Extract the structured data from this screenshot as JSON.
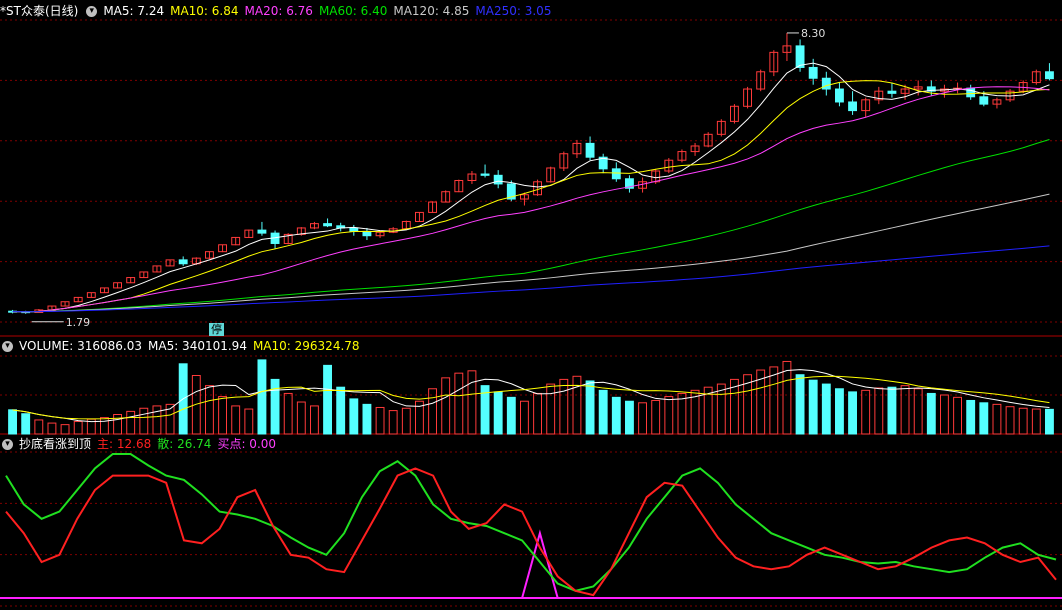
{
  "colors": {
    "up": "#ff3a3a",
    "down": "#54ffff",
    "ma5": "#ffffff",
    "ma10": "#ffff00",
    "ma20": "#ff40ff",
    "ma60": "#00e000",
    "ma120": "#c8c8c8",
    "ma250": "#2020ff",
    "main": "#ff2020",
    "retail": "#20e020",
    "buy": "#ff20ff",
    "grid": "#800000"
  },
  "price_panel": {
    "title": "*ST众泰(日线)",
    "icon": "chevron-down-icon",
    "ma5_label": "MA5: 7.24",
    "ma10_label": "MA10: 6.84",
    "ma20_label": "MA20: 6.76",
    "ma60_label": "MA60: 6.40",
    "ma120_label": "MA120: 4.85",
    "ma250_label": "MA250: 3.05",
    "high_label": "8.30",
    "low_label": "1.79",
    "halt_label": "停"
  },
  "volume_panel": {
    "icon": "chevron-down-icon",
    "volume_label": "VOLUME: 316086.03",
    "ma5_label": "MA5: 340101.94",
    "ma10_label": "MA10: 296324.78"
  },
  "indicator_panel": {
    "icon": "chevron-down-icon",
    "name": "抄底看涨到顶",
    "main_label": "主: 12.68",
    "retail_label": "散: 26.74",
    "buy_label": "买点: 0.00"
  },
  "chart_data": [
    {
      "type": "candlestick",
      "title": "*ST众泰(日线)",
      "ylim": [
        1.6,
        8.6
      ],
      "annotations": [
        {
          "text": "8.30",
          "kind": "high"
        },
        {
          "text": "1.79",
          "kind": "low"
        },
        {
          "text": "停",
          "kind": "halt"
        }
      ],
      "ohlc": [
        [
          1.85,
          1.88,
          1.8,
          1.84
        ],
        [
          1.84,
          1.86,
          1.79,
          1.82
        ],
        [
          1.82,
          1.9,
          1.81,
          1.88
        ],
        [
          1.88,
          1.97,
          1.87,
          1.97
        ],
        [
          1.97,
          2.07,
          1.96,
          2.07
        ],
        [
          2.07,
          2.18,
          2.06,
          2.17
        ],
        [
          2.17,
          2.28,
          2.16,
          2.28
        ],
        [
          2.28,
          2.4,
          2.27,
          2.39
        ],
        [
          2.39,
          2.51,
          2.38,
          2.51
        ],
        [
          2.51,
          2.64,
          2.5,
          2.63
        ],
        [
          2.63,
          2.77,
          2.62,
          2.76
        ],
        [
          2.76,
          2.9,
          2.75,
          2.9
        ],
        [
          2.9,
          3.04,
          2.89,
          3.04
        ],
        [
          3.04,
          3.12,
          2.9,
          2.95
        ],
        [
          2.95,
          3.1,
          2.92,
          3.08
        ],
        [
          3.08,
          3.24,
          3.06,
          3.23
        ],
        [
          3.23,
          3.39,
          3.22,
          3.39
        ],
        [
          3.39,
          3.56,
          3.38,
          3.56
        ],
        [
          3.56,
          3.74,
          3.55,
          3.73
        ],
        [
          3.73,
          3.92,
          3.6,
          3.66
        ],
        [
          3.66,
          3.72,
          3.3,
          3.42
        ],
        [
          3.42,
          3.66,
          3.4,
          3.63
        ],
        [
          3.63,
          3.8,
          3.6,
          3.78
        ],
        [
          3.78,
          3.92,
          3.75,
          3.88
        ],
        [
          3.88,
          4.0,
          3.8,
          3.83
        ],
        [
          3.83,
          3.9,
          3.7,
          3.78
        ],
        [
          3.78,
          3.85,
          3.6,
          3.7
        ],
        [
          3.7,
          3.78,
          3.5,
          3.6
        ],
        [
          3.6,
          3.72,
          3.55,
          3.68
        ],
        [
          3.68,
          3.8,
          3.66,
          3.76
        ],
        [
          3.76,
          3.95,
          3.74,
          3.93
        ],
        [
          3.93,
          4.15,
          3.92,
          4.14
        ],
        [
          4.14,
          4.4,
          4.13,
          4.38
        ],
        [
          4.38,
          4.65,
          4.37,
          4.62
        ],
        [
          4.62,
          4.9,
          4.61,
          4.88
        ],
        [
          4.88,
          5.1,
          4.8,
          5.03
        ],
        [
          5.03,
          5.25,
          4.95,
          5.0
        ],
        [
          5.0,
          5.12,
          4.7,
          4.8
        ],
        [
          4.8,
          4.88,
          4.4,
          4.45
        ],
        [
          4.45,
          4.6,
          4.3,
          4.55
        ],
        [
          4.55,
          4.9,
          4.52,
          4.85
        ],
        [
          4.85,
          5.2,
          4.83,
          5.17
        ],
        [
          5.17,
          5.55,
          5.1,
          5.5
        ],
        [
          5.5,
          5.82,
          5.4,
          5.74
        ],
        [
          5.74,
          5.9,
          5.35,
          5.42
        ],
        [
          5.42,
          5.5,
          5.05,
          5.15
        ],
        [
          5.15,
          5.3,
          4.85,
          4.92
        ],
        [
          4.92,
          5.0,
          4.6,
          4.7
        ],
        [
          4.7,
          4.95,
          4.6,
          4.85
        ],
        [
          4.85,
          5.15,
          4.8,
          5.1
        ],
        [
          5.1,
          5.4,
          5.05,
          5.35
        ],
        [
          5.35,
          5.6,
          5.3,
          5.55
        ],
        [
          5.55,
          5.75,
          5.45,
          5.68
        ],
        [
          5.68,
          6.0,
          5.65,
          5.95
        ],
        [
          5.95,
          6.3,
          5.9,
          6.25
        ],
        [
          6.25,
          6.65,
          6.2,
          6.6
        ],
        [
          6.6,
          7.05,
          6.55,
          7.0
        ],
        [
          7.0,
          7.45,
          6.95,
          7.4
        ],
        [
          7.4,
          7.9,
          7.3,
          7.85
        ],
        [
          7.85,
          8.3,
          7.65,
          8.0
        ],
        [
          8.0,
          8.15,
          7.4,
          7.5
        ],
        [
          7.5,
          7.7,
          7.1,
          7.25
        ],
        [
          7.25,
          7.4,
          6.85,
          7.0
        ],
        [
          7.0,
          7.15,
          6.6,
          6.7
        ],
        [
          6.7,
          6.95,
          6.4,
          6.5
        ],
        [
          6.5,
          6.8,
          6.35,
          6.75
        ],
        [
          6.75,
          7.05,
          6.65,
          6.95
        ],
        [
          6.95,
          7.15,
          6.8,
          6.9
        ],
        [
          6.9,
          7.1,
          6.75,
          7.0
        ],
        [
          7.0,
          7.2,
          6.85,
          7.05
        ],
        [
          7.05,
          7.2,
          6.85,
          6.95
        ],
        [
          6.95,
          7.1,
          6.8,
          7.0
        ],
        [
          7.0,
          7.15,
          6.9,
          7.02
        ],
        [
          7.02,
          7.1,
          6.75,
          6.82
        ],
        [
          6.82,
          6.95,
          6.6,
          6.65
        ],
        [
          6.65,
          6.8,
          6.55,
          6.75
        ],
        [
          6.75,
          7.0,
          6.7,
          6.95
        ],
        [
          6.95,
          7.2,
          6.9,
          7.15
        ],
        [
          7.15,
          7.45,
          7.1,
          7.4
        ],
        [
          7.4,
          7.6,
          7.2,
          7.24
        ]
      ],
      "ma_series": [
        "MA5",
        "MA10",
        "MA20",
        "MA60",
        "MA120",
        "MA250"
      ]
    },
    {
      "type": "bar",
      "title": "VOLUME",
      "ylim": [
        0,
        1000000
      ],
      "series": [
        {
          "name": "VOLUME",
          "values": [
            310000,
            260000,
            180000,
            140000,
            120000,
            160000,
            190000,
            210000,
            250000,
            290000,
            330000,
            360000,
            380000,
            900000,
            750000,
            620000,
            480000,
            360000,
            320000,
            950000,
            700000,
            520000,
            410000,
            360000,
            880000,
            600000,
            450000,
            380000,
            340000,
            300000,
            330000,
            420000,
            580000,
            720000,
            780000,
            810000,
            620000,
            540000,
            470000,
            420000,
            520000,
            640000,
            700000,
            740000,
            680000,
            560000,
            470000,
            420000,
            400000,
            430000,
            480000,
            520000,
            560000,
            600000,
            640000,
            700000,
            760000,
            820000,
            860000,
            930000,
            760000,
            690000,
            640000,
            580000,
            540000,
            560000,
            590000,
            600000,
            620000,
            580000,
            520000,
            500000,
            470000,
            430000,
            400000,
            380000,
            350000,
            330000,
            320000,
            316086
          ]
        }
      ]
    },
    {
      "type": "line",
      "title": "抄底看涨到顶",
      "series": [
        {
          "name": "主",
          "values": [
            60,
            45,
            25,
            30,
            55,
            75,
            85,
            85,
            85,
            80,
            40,
            38,
            48,
            70,
            75,
            50,
            30,
            28,
            20,
            18,
            40,
            62,
            85,
            90,
            85,
            60,
            48,
            52,
            65,
            60,
            35,
            15,
            5,
            2,
            20,
            45,
            70,
            80,
            78,
            60,
            42,
            28,
            22,
            20,
            22,
            30,
            35,
            30,
            25,
            20,
            22,
            28,
            35,
            40,
            42,
            38,
            30,
            25,
            28,
            12.68
          ]
        },
        {
          "name": "散",
          "values": [
            85,
            65,
            55,
            60,
            75,
            90,
            100,
            100,
            92,
            85,
            82,
            72,
            60,
            58,
            55,
            50,
            42,
            35,
            30,
            45,
            70,
            88,
            95,
            85,
            65,
            55,
            52,
            50,
            45,
            40,
            25,
            10,
            5,
            8,
            20,
            35,
            55,
            70,
            85,
            90,
            80,
            65,
            55,
            45,
            40,
            35,
            30,
            28,
            25,
            24,
            25,
            22,
            20,
            18,
            20,
            28,
            35,
            38,
            30,
            26.74
          ]
        },
        {
          "name": "买点",
          "values": [
            0,
            0,
            0,
            0,
            0,
            0,
            0,
            0,
            0,
            0,
            0,
            0,
            0,
            0,
            0,
            0,
            0,
            0,
            0,
            0,
            0,
            0,
            0,
            0,
            0,
            0,
            0,
            0,
            0,
            0,
            45,
            0,
            0,
            0,
            0,
            0,
            0,
            0,
            0,
            0,
            0,
            0,
            0,
            0,
            0,
            0,
            0,
            0,
            0,
            0,
            0,
            0,
            0,
            0,
            0,
            0,
            0,
            0,
            0,
            0.0
          ]
        }
      ]
    }
  ]
}
